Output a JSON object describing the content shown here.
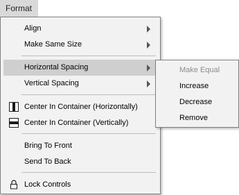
{
  "menubar": {
    "format_label": "Format"
  },
  "menu": {
    "align_label": "Align",
    "make_same_size_label": "Make Same Size",
    "horizontal_spacing_label": "Horizontal Spacing",
    "vertical_spacing_label": "Vertical Spacing",
    "center_horizontally_label": "Center In Container (Horizontally)",
    "center_vertically_label": "Center In Container (Vertically)",
    "bring_to_front_label": "Bring To Front",
    "send_to_back_label": "Send To Back",
    "lock_controls_label": "Lock Controls"
  },
  "submenu": {
    "make_equal_label": "Make Equal",
    "increase_label": "Increase",
    "decrease_label": "Decrease",
    "remove_label": "Remove"
  },
  "colors": {
    "menu_background": "#f2f2f2",
    "highlight": "#cfcfcf",
    "menubar_active": "#d9d9d9",
    "disabled_text": "#8c8c8c"
  },
  "icons": {
    "center_horizontally": "center-horizontally-icon",
    "center_vertically": "center-vertically-icon",
    "lock": "lock-icon",
    "submenu_arrow": "chevron-right-icon"
  }
}
